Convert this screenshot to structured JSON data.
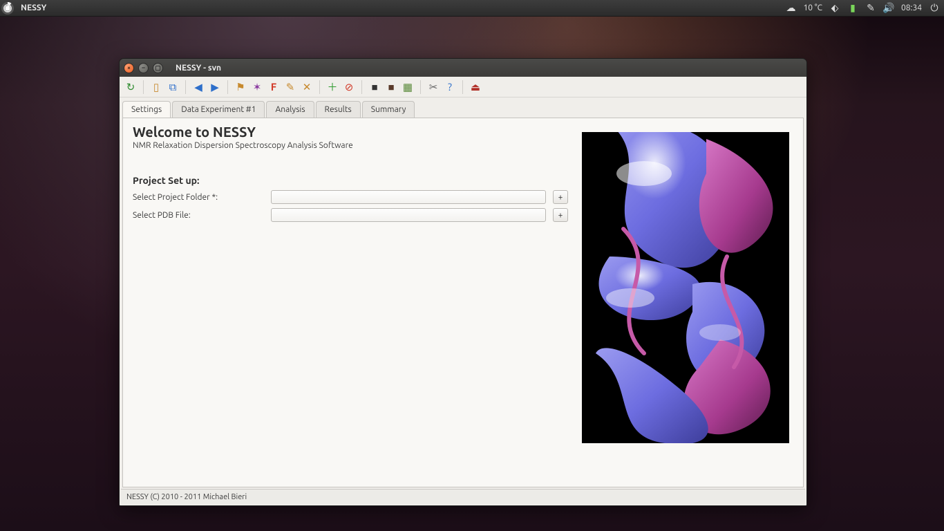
{
  "panel": {
    "app_name": "NESSY",
    "weather": "10 °C",
    "time": "08:34"
  },
  "window": {
    "title": "NESSY - svn"
  },
  "tabs": [
    {
      "label": "Settings"
    },
    {
      "label": "Data Experiment #1"
    },
    {
      "label": "Analysis"
    },
    {
      "label": "Results"
    },
    {
      "label": "Summary"
    }
  ],
  "content": {
    "welcome_title": "Welcome to NESSY",
    "subtitle": "NMR Relaxation Dispersion Spectroscopy Analysis Software",
    "section_title": "Project Set up:",
    "project_folder_label": "Select Project Folder *:",
    "project_folder_value": "",
    "pdb_file_label": "Select PDB File:",
    "pdb_file_value": "",
    "plus_label": "+"
  },
  "status": {
    "text": "NESSY (C) 2010 - 2011 Michael Bieri"
  },
  "toolbar_icons": [
    {
      "name": "refresh-icon",
      "glyph": "↻",
      "color": "#2e8b2e"
    },
    {
      "name": "sep"
    },
    {
      "name": "document-icon",
      "glyph": "▯",
      "color": "#c78a2e"
    },
    {
      "name": "copy-icon",
      "glyph": "⧉",
      "color": "#2e6fca"
    },
    {
      "name": "sep"
    },
    {
      "name": "nav-back-icon",
      "glyph": "◀",
      "color": "#2e6fca"
    },
    {
      "name": "nav-forward-icon",
      "glyph": "▶",
      "color": "#2e6fca"
    },
    {
      "name": "sep"
    },
    {
      "name": "flag-icon",
      "glyph": "⚑",
      "color": "#c78a2e"
    },
    {
      "name": "molecule-icon",
      "glyph": "✶",
      "color": "#8a3aa0"
    },
    {
      "name": "letter-f-icon",
      "glyph": "F",
      "color": "#d23b2a"
    },
    {
      "name": "pencil-icon",
      "glyph": "✎",
      "color": "#c78a2e"
    },
    {
      "name": "cross-icon",
      "glyph": "✕",
      "color": "#c78a2e"
    },
    {
      "name": "sep"
    },
    {
      "name": "add-icon",
      "glyph": "＋",
      "color": "#2e9a2e"
    },
    {
      "name": "stop-icon",
      "glyph": "⊘",
      "color": "#d23b2a"
    },
    {
      "name": "sep"
    },
    {
      "name": "square-icon",
      "glyph": "■",
      "color": "#333"
    },
    {
      "name": "square2-icon",
      "glyph": "■",
      "color": "#5a3a2a"
    },
    {
      "name": "chart-icon",
      "glyph": "▦",
      "color": "#5a8a3a"
    },
    {
      "name": "sep"
    },
    {
      "name": "tools-icon",
      "glyph": "✂",
      "color": "#666"
    },
    {
      "name": "help-icon",
      "glyph": "?",
      "color": "#2e6fca"
    },
    {
      "name": "sep"
    },
    {
      "name": "exit-icon",
      "glyph": "⏏",
      "color": "#b03028"
    }
  ]
}
